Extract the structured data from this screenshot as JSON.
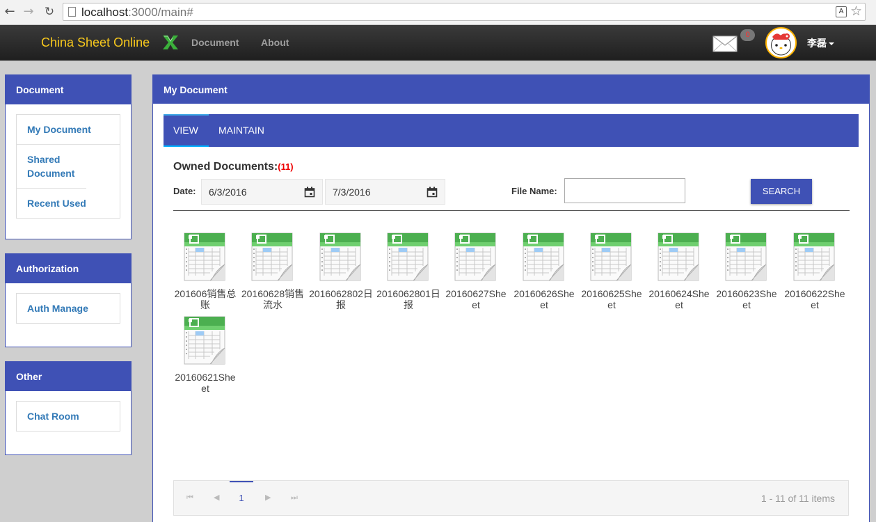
{
  "browser": {
    "url_host": "localhost",
    "url_rest": ":3000/main#",
    "translate_icon": "A"
  },
  "topnav": {
    "brand": "China Sheet Online",
    "links": [
      "Document",
      "About"
    ],
    "mail_badge": "0",
    "user_name": "李磊"
  },
  "sidebar": {
    "document": {
      "title": "Document",
      "items": [
        "My Document",
        "Shared Document",
        "Recent Used"
      ]
    },
    "authorization": {
      "title": "Authorization",
      "items": [
        "Auth Manage"
      ]
    },
    "other": {
      "title": "Other",
      "items": [
        "Chat Room"
      ]
    }
  },
  "main": {
    "title": "My Document",
    "tabs": [
      "VIEW",
      "MAINTAIN"
    ],
    "owned_label": "Owned Documents:",
    "owned_count": "(11)",
    "date_label": "Date:",
    "date_from": "6/3/2016",
    "date_to": "7/3/2016",
    "file_name_label": "File Name:",
    "file_name_value": "",
    "search_label": "SEARCH",
    "files": [
      "201606销售总账",
      "20160628销售流水",
      "2016062802日报",
      "2016062801日报",
      "20160627Sheet",
      "20160626Sheet",
      "20160625Sheet",
      "20160624Sheet",
      "20160623Sheet",
      "20160622Sheet",
      "20160621Sheet"
    ],
    "pager": {
      "current_page": "1",
      "info": "1 - 11 of 11 items"
    }
  },
  "colors": {
    "primary": "#3f51b5",
    "brand": "#f7c81d",
    "count": "#e00000"
  }
}
